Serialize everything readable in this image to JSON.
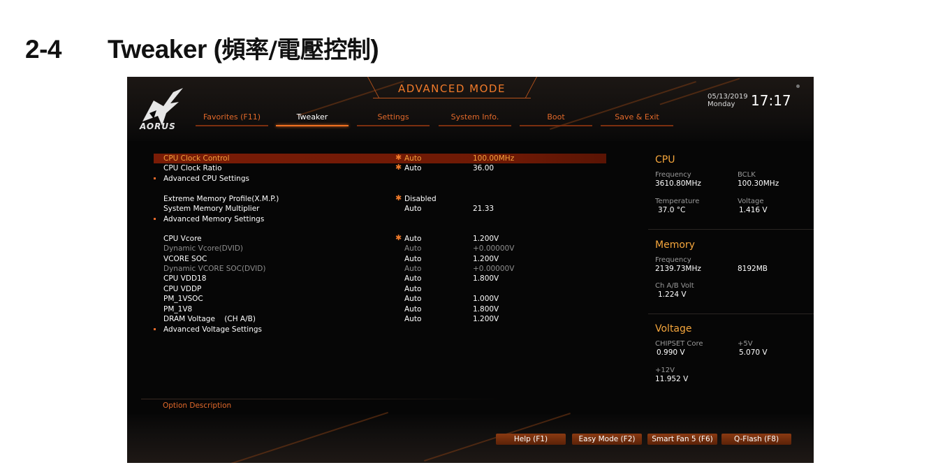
{
  "heading": {
    "number": "2-4",
    "title": "Tweaker (",
    "title_cjk": "頻率/電壓控制",
    "title_end": ")"
  },
  "header": {
    "mode_title": "ADVANCED MODE",
    "date": "05/13/2019",
    "day": "Monday",
    "time": "17:17",
    "logo": "AORUS"
  },
  "tabs": [
    {
      "label": "Favorites (F11)",
      "active": false
    },
    {
      "label": "Tweaker",
      "active": true
    },
    {
      "label": "Settings",
      "active": false
    },
    {
      "label": "System Info.",
      "active": false
    },
    {
      "label": "Boot",
      "active": false
    },
    {
      "label": "Save & Exit",
      "active": false
    }
  ],
  "menu": [
    {
      "label": "CPU Clock Control",
      "star": true,
      "value": "Auto",
      "value2": "100.00MHz"
    },
    {
      "label": "CPU Clock Ratio",
      "star": true,
      "value": "Auto",
      "value2": "36.00"
    },
    {
      "label": "Advanced CPU Settings"
    },
    {
      "label": "Extreme Memory Profile(X.M.P.)",
      "star": true,
      "value": "Disabled",
      "value2": ""
    },
    {
      "label": "System Memory Multiplier",
      "value": "Auto",
      "value2": "21.33"
    },
    {
      "label": "Advanced Memory Settings"
    },
    {
      "label": "CPU Vcore",
      "star": true,
      "value": "Auto",
      "value2": "1.200V"
    },
    {
      "label": "Dynamic Vcore(DVID)",
      "value": "Auto",
      "value2": "+0.00000V"
    },
    {
      "label": "VCORE SOC",
      "value": "Auto",
      "value2": "1.200V"
    },
    {
      "label": "Dynamic VCORE SOC(DVID)",
      "value": "Auto",
      "value2": "+0.00000V"
    },
    {
      "label": "CPU VDD18",
      "value": "Auto",
      "value2": "1.800V"
    },
    {
      "label": "CPU VDDP",
      "value": "Auto",
      "value2": ""
    },
    {
      "label": "PM_1VSOC",
      "value": "Auto",
      "value2": "1.000V"
    },
    {
      "label": "PM_1V8",
      "value": "Auto",
      "value2": "1.800V"
    },
    {
      "label": "DRAM Voltage    (CH A/B)",
      "value": "Auto",
      "value2": "1.200V"
    },
    {
      "label": "Advanced Voltage Settings"
    }
  ],
  "option_description": "Option Description",
  "side_panel": {
    "cpu": {
      "title": "CPU",
      "frequency_label": "Frequency",
      "frequency": "3610.80MHz",
      "bclk_label": "BCLK",
      "bclk": "100.30MHz",
      "temperature_label": "Temperature",
      "temperature": "37.0 °C",
      "voltage_label": "Voltage",
      "voltage": "1.416 V"
    },
    "memory": {
      "title": "Memory",
      "frequency_label": "Frequency",
      "frequency": "2139.73MHz",
      "size": "8192MB",
      "volt_label": "Ch A/B Volt",
      "volt": "1.224 V"
    },
    "voltage": {
      "title": "Voltage",
      "chipset_label": "CHIPSET Core",
      "chipset": "0.990 V",
      "p5v_label": "+5V",
      "p5v": "5.070 V",
      "p12v_label": "+12V",
      "p12v": "11.952 V"
    }
  },
  "footer_buttons": [
    "Help (F1)",
    "Easy Mode (F2)",
    "Smart Fan 5 (F6)",
    "Q-Flash (F8)"
  ],
  "colors": {
    "accent": "#f07a2a",
    "selection": "#7a1c06",
    "side_title": "#f5a63c",
    "background": "#060606"
  }
}
